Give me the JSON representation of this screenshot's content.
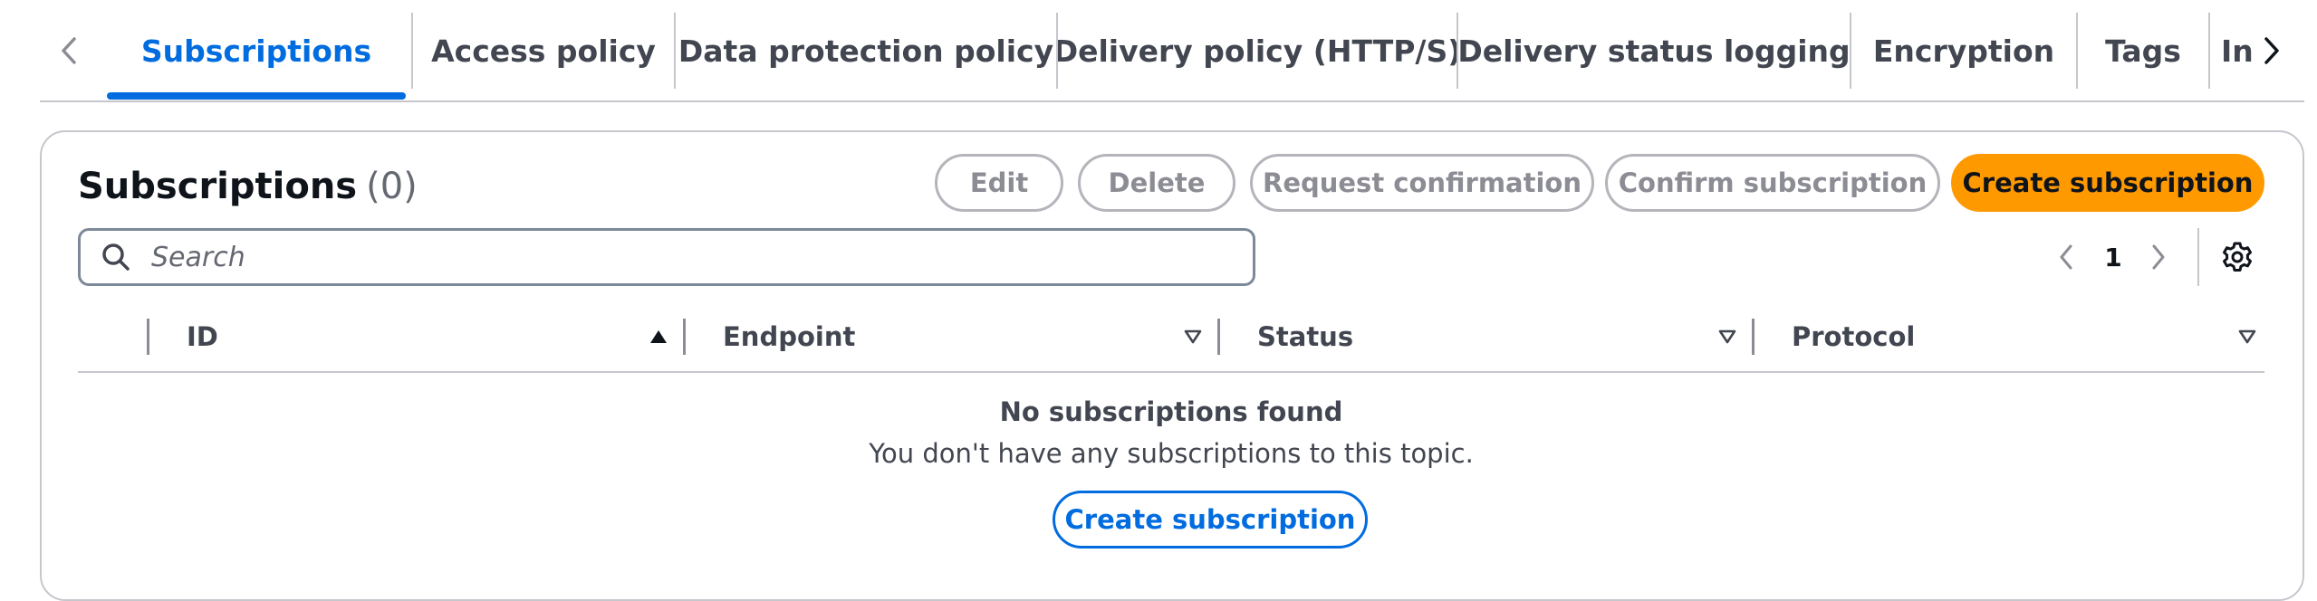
{
  "tabs": [
    {
      "label": "Subscriptions",
      "active": true
    },
    {
      "label": "Access policy"
    },
    {
      "label": "Data protection policy"
    },
    {
      "label": "Delivery policy (HTTP/S)"
    },
    {
      "label": "Delivery status logging"
    },
    {
      "label": "Encryption"
    },
    {
      "label": "Tags"
    },
    {
      "label": "In"
    }
  ],
  "section": {
    "title": "Subscriptions",
    "count": "(0)"
  },
  "actions": {
    "edit": "Edit",
    "delete": "Delete",
    "request_confirmation": "Request confirmation",
    "confirm_subscription": "Confirm subscription",
    "create_subscription": "Create subscription"
  },
  "search": {
    "placeholder": "Search"
  },
  "pagination": {
    "current_page": "1"
  },
  "table": {
    "columns": [
      "ID",
      "Endpoint",
      "Status",
      "Protocol"
    ],
    "sort": {
      "ID": "ascending"
    }
  },
  "empty_state": {
    "title": "No subscriptions found",
    "description": "You don't have any subscriptions to this topic.",
    "button": "Create subscription"
  },
  "colors": {
    "accent": "#006ce0",
    "primary_button": "#ff9900",
    "border": "#c6c6cd"
  },
  "icons": {
    "tab_prev": "chevron-left-icon",
    "tab_next": "chevron-right-icon",
    "search": "search-icon",
    "page_prev": "chevron-left-icon",
    "page_next": "chevron-right-icon",
    "settings": "gear-icon",
    "sort_asc": "triangle-up-filled-icon",
    "sort_none": "triangle-down-outline-icon"
  }
}
